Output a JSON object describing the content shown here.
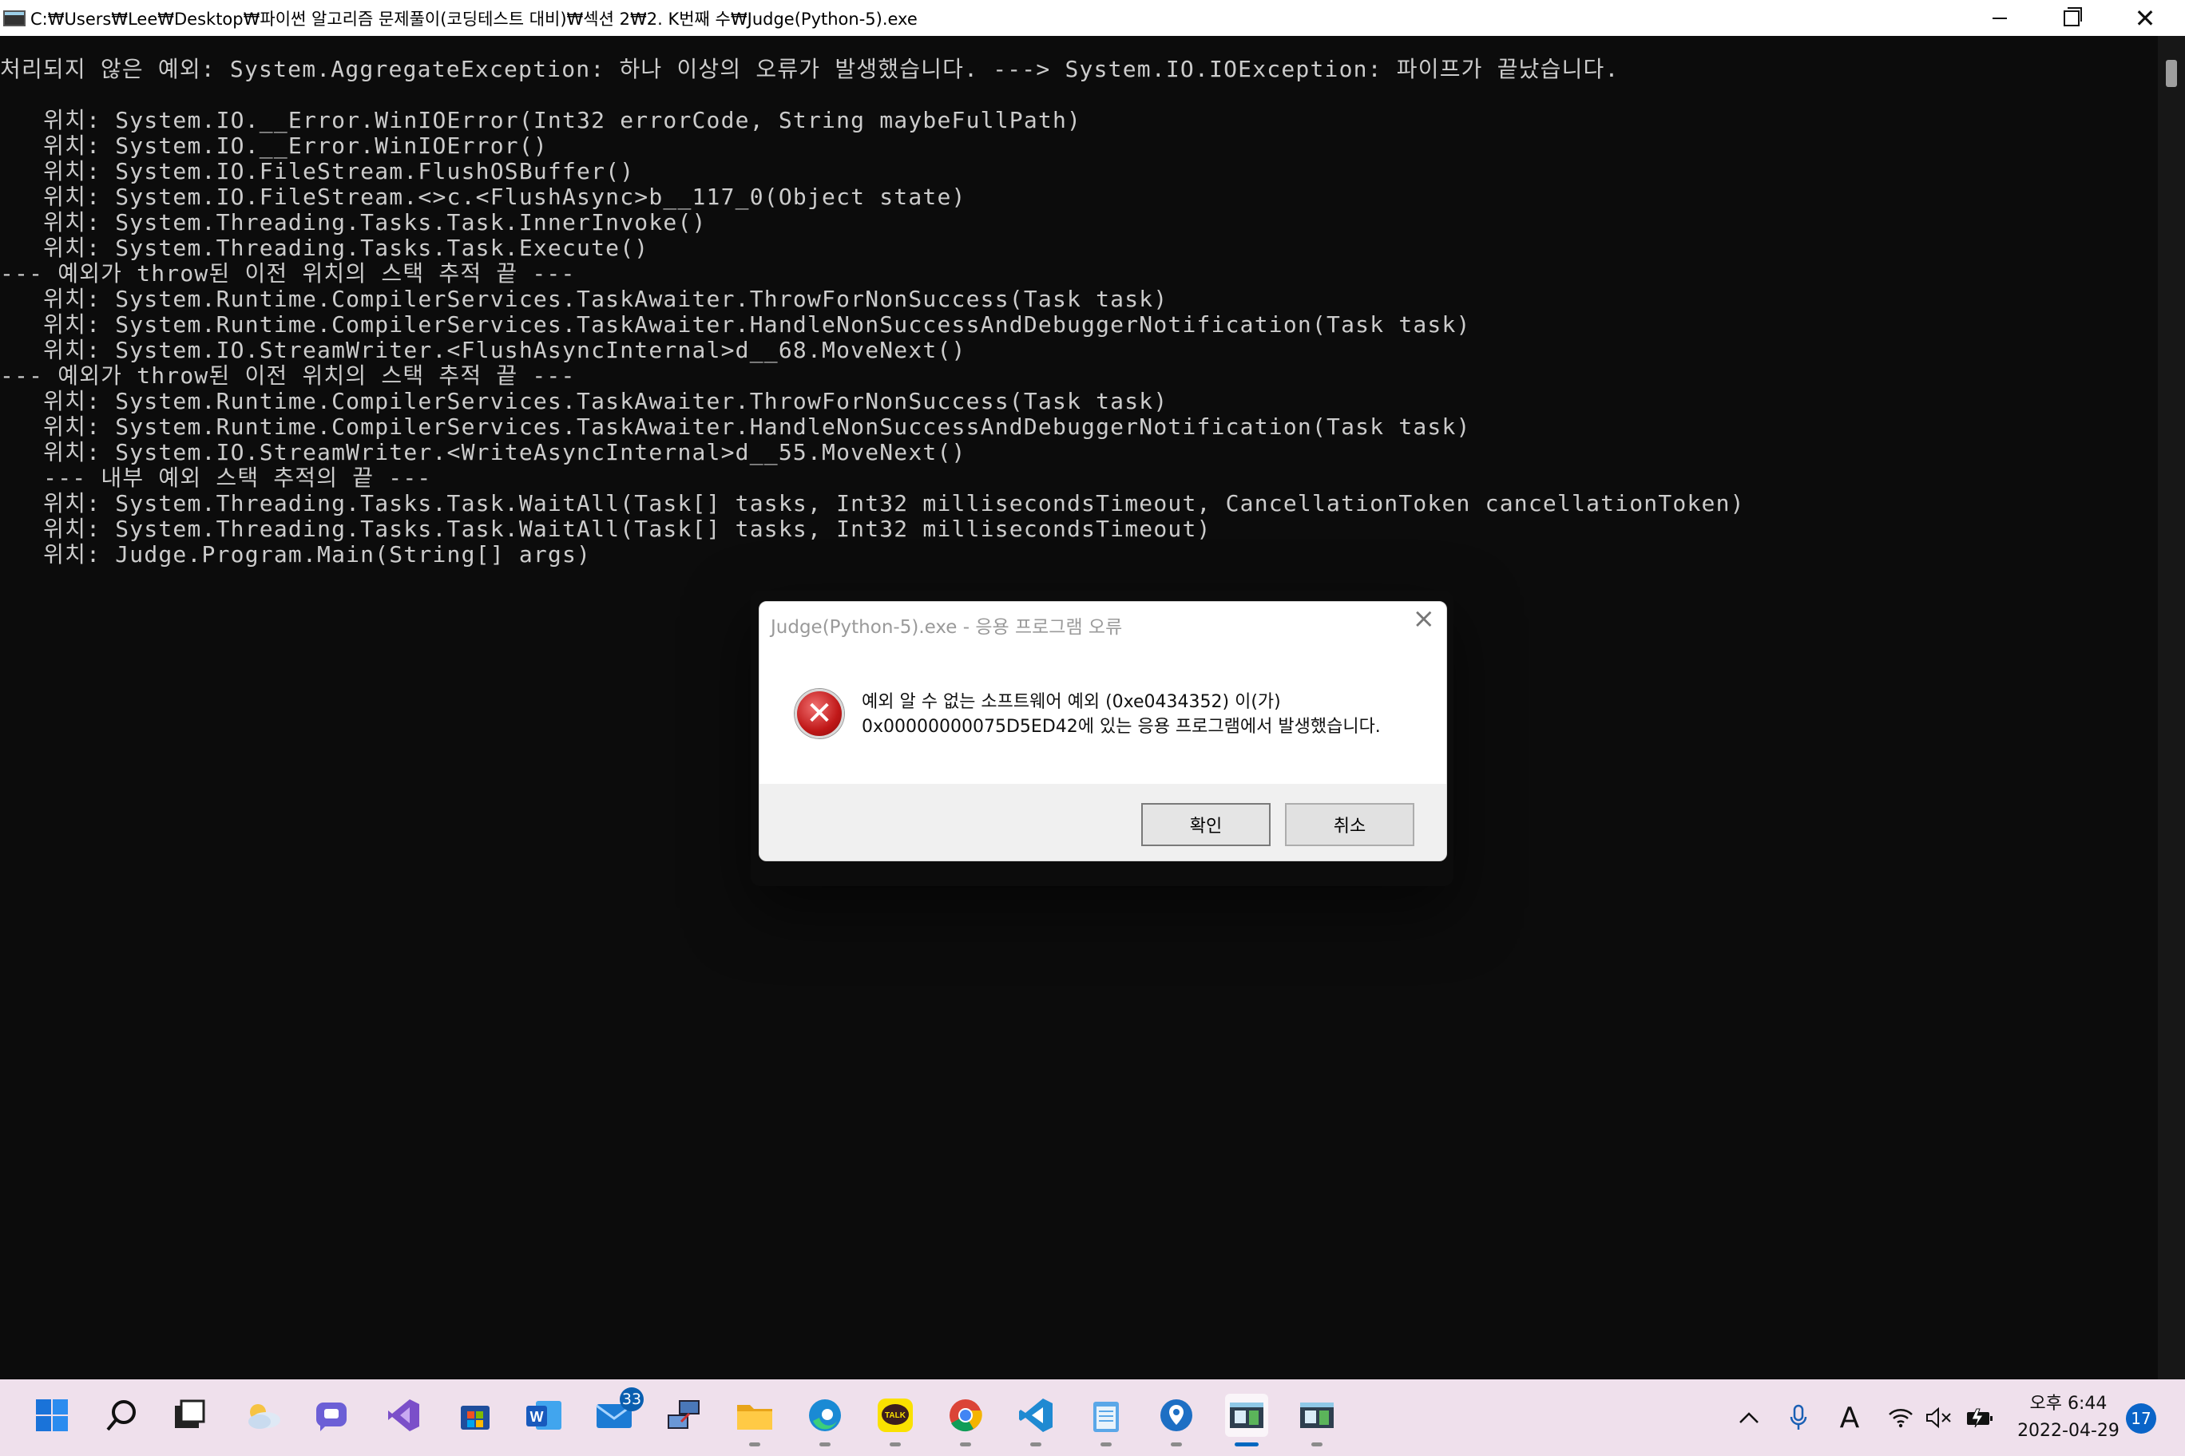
{
  "window": {
    "title": "C:₩Users₩Lee₩Desktop₩파이썬 알고리즘 문제풀이(코딩테스트 대비)₩섹션 2₩2. K번째 수₩Judge(Python-5).exe"
  },
  "console": {
    "lines": [
      "처리되지 않은 예외: System.AggregateException: 하나 이상의 오류가 발생했습니다. ---> System.IO.IOException: 파이프가 끝났습니다.",
      "",
      "   위치: System.IO.__Error.WinIOError(Int32 errorCode, String maybeFullPath)",
      "   위치: System.IO.__Error.WinIOError()",
      "   위치: System.IO.FileStream.FlushOSBuffer()",
      "   위치: System.IO.FileStream.<>c.<FlushAsync>b__117_0(Object state)",
      "   위치: System.Threading.Tasks.Task.InnerInvoke()",
      "   위치: System.Threading.Tasks.Task.Execute()",
      "--- 예외가 throw된 이전 위치의 스택 추적 끝 ---",
      "   위치: System.Runtime.CompilerServices.TaskAwaiter.ThrowForNonSuccess(Task task)",
      "   위치: System.Runtime.CompilerServices.TaskAwaiter.HandleNonSuccessAndDebuggerNotification(Task task)",
      "   위치: System.IO.StreamWriter.<FlushAsyncInternal>d__68.MoveNext()",
      "--- 예외가 throw된 이전 위치의 스택 추적 끝 ---",
      "   위치: System.Runtime.CompilerServices.TaskAwaiter.ThrowForNonSuccess(Task task)",
      "   위치: System.Runtime.CompilerServices.TaskAwaiter.HandleNonSuccessAndDebuggerNotification(Task task)",
      "   위치: System.IO.StreamWriter.<WriteAsyncInternal>d__55.MoveNext()",
      "   --- 내부 예외 스택 추적의 끝 ---",
      "   위치: System.Threading.Tasks.Task.WaitAll(Task[] tasks, Int32 millisecondsTimeout, CancellationToken cancellationToken)",
      "   위치: System.Threading.Tasks.Task.WaitAll(Task[] tasks, Int32 millisecondsTimeout)",
      "   위치: Judge.Program.Main(String[] args)"
    ]
  },
  "dialog": {
    "title": "Judge(Python-5).exe - 응용 프로그램 오류",
    "message_line1": "예외 알 수 없는 소프트웨어 예외 (0xe0434352) 이(가)",
    "message_line2": "0x00000000075D5ED42에 있는 응용 프로그램에서 발생했습니다.",
    "ok_label": "확인",
    "cancel_label": "취소",
    "icon": "error-icon"
  },
  "taskbar": {
    "mail_badge": "33",
    "clock_time": "오후 6:44",
    "clock_date": "2022-04-29",
    "notification_count": "17",
    "ime_label": "A",
    "apps": [
      "start-icon",
      "search-icon",
      "task-view-icon",
      "widgets-icon",
      "chat-icon",
      "visual-studio-icon",
      "store-icon",
      "word-icon",
      "mail-icon",
      "network-tool-icon",
      "file-explorer-icon",
      "edge-icon",
      "kakaotalk-icon",
      "chrome-icon",
      "vscode-icon",
      "notepad-icon",
      "maps-icon",
      "console-icon",
      "console-icon-2"
    ],
    "kakao_label": "TALK",
    "word_label": "W"
  }
}
